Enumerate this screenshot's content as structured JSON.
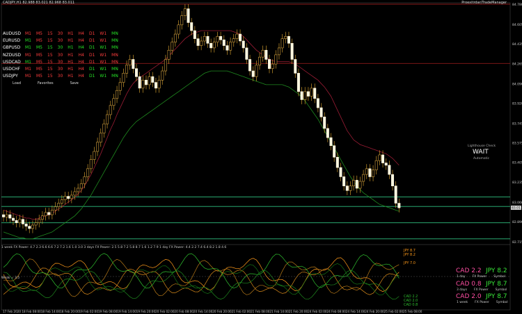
{
  "header": {
    "title": "CADJPY,H1  82.988 83.021 82.968 83.011",
    "right_label": "Proexitrdar/TradeManager"
  },
  "symbols": [
    {
      "name": "AUDUSD",
      "tfs": [
        {
          "l": "M1",
          "c": "#ff3d3d"
        },
        {
          "l": "M5",
          "c": "#ff3d3d"
        },
        {
          "l": "15",
          "c": "#ff3d3d"
        },
        {
          "l": "30",
          "c": "#ff3d3d"
        },
        {
          "l": "H1",
          "c": "#ff3d3d"
        },
        {
          "l": "H4",
          "c": "#ff3d3d"
        },
        {
          "l": "D1",
          "c": "#ff3d3d"
        },
        {
          "l": "W1",
          "c": "#ff3d3d"
        },
        {
          "l": "MN",
          "c": "#27e627"
        }
      ]
    },
    {
      "name": "EURUSD",
      "tfs": [
        {
          "l": "M1",
          "c": "#27e627"
        },
        {
          "l": "M5",
          "c": "#ff3d3d"
        },
        {
          "l": "15",
          "c": "#ff3d3d"
        },
        {
          "l": "30",
          "c": "#ff3d3d"
        },
        {
          "l": "H1",
          "c": "#ff3d3d"
        },
        {
          "l": "H4",
          "c": "#ff3d3d"
        },
        {
          "l": "D1",
          "c": "#ff3d3d"
        },
        {
          "l": "W1",
          "c": "#ff3d3d"
        },
        {
          "l": "MN",
          "c": "#27e627"
        }
      ]
    },
    {
      "name": "GBPUSD",
      "tfs": [
        {
          "l": "M1",
          "c": "#27e627"
        },
        {
          "l": "M5",
          "c": "#27e627"
        },
        {
          "l": "15",
          "c": "#27e627"
        },
        {
          "l": "30",
          "c": "#27e627"
        },
        {
          "l": "H1",
          "c": "#27e627"
        },
        {
          "l": "H4",
          "c": "#27e627"
        },
        {
          "l": "D1",
          "c": "#27e627"
        },
        {
          "l": "W1",
          "c": "#27e627"
        },
        {
          "l": "MN",
          "c": "#27e627"
        }
      ]
    },
    {
      "name": "NZDUSD",
      "tfs": [
        {
          "l": "M1",
          "c": "#ff3d3d"
        },
        {
          "l": "M5",
          "c": "#ff3d3d"
        },
        {
          "l": "15",
          "c": "#ff3d3d"
        },
        {
          "l": "30",
          "c": "#ff3d3d"
        },
        {
          "l": "H1",
          "c": "#ff3d3d"
        },
        {
          "l": "H4",
          "c": "#ff3d3d"
        },
        {
          "l": "D1",
          "c": "#ff3d3d"
        },
        {
          "l": "W1",
          "c": "#ff3d3d"
        },
        {
          "l": "MN",
          "c": "#ff3d3d"
        }
      ]
    },
    {
      "name": "USDCAD",
      "tfs": [
        {
          "l": "M1",
          "c": "#27e627"
        },
        {
          "l": "M5",
          "c": "#ff3d3d"
        },
        {
          "l": "15",
          "c": "#ff3d3d"
        },
        {
          "l": "30",
          "c": "#ff3d3d"
        },
        {
          "l": "H1",
          "c": "#ff3d3d"
        },
        {
          "l": "H4",
          "c": "#ff3d3d"
        },
        {
          "l": "D1",
          "c": "#ff3d3d"
        },
        {
          "l": "W1",
          "c": "#ff3d3d"
        },
        {
          "l": "MN",
          "c": "#ff3d3d"
        }
      ]
    },
    {
      "name": "USDCHF",
      "tfs": [
        {
          "l": "M1",
          "c": "#ff3d3d"
        },
        {
          "l": "M5",
          "c": "#ff3d3d"
        },
        {
          "l": "15",
          "c": "#ff3d3d"
        },
        {
          "l": "30",
          "c": "#ff3d3d"
        },
        {
          "l": "H1",
          "c": "#ff3d3d"
        },
        {
          "l": "H4",
          "c": "#ff3d3d"
        },
        {
          "l": "D1",
          "c": "#27e627"
        },
        {
          "l": "W1",
          "c": "#27e627"
        },
        {
          "l": "MN",
          "c": "#27e627"
        }
      ]
    },
    {
      "name": "USDJPY",
      "tfs": [
        {
          "l": "M1",
          "c": "#ff3d3d"
        },
        {
          "l": "M5",
          "c": "#ff3d3d"
        },
        {
          "l": "15",
          "c": "#ff3d3d"
        },
        {
          "l": "30",
          "c": "#ff3d3d"
        },
        {
          "l": "H1",
          "c": "#ff3d3d"
        },
        {
          "l": "H4",
          "c": "#ff3d3d"
        },
        {
          "l": "D1",
          "c": "#27e627"
        },
        {
          "l": "W1",
          "c": "#27e627"
        },
        {
          "l": "MN",
          "c": "#27e627"
        }
      ]
    }
  ],
  "panel_links": {
    "load": "Load",
    "favorites": "Favorites",
    "save": "Save"
  },
  "lighthouse": {
    "title": "Lighthouse Check",
    "status": "WAIT",
    "mode": "Automatic"
  },
  "indicator_label": "1 week FX Power: 4.7 2.3 6.6 6.6 7.2 7.2 1.6 1.0 3.0   3 days FX Power: 2.5 5.8 7.2 5.8 8.7 1.6 1.2 7.9   1 day FX Power: 4.4 2.2 7.4 6.4 8.2 1.8 4.6",
  "weak_label": "Weak = 3.5",
  "fx_power": [
    {
      "a": "CAD 2.2",
      "b": "JPY 8.2",
      "sub": [
        "1 day",
        "FX Power",
        "Symbol"
      ],
      "ac": "#ff4fa3",
      "bc": "#39e639"
    },
    {
      "a": "CAD 0.8",
      "b": "JPY 8.7",
      "sub": [
        "3 days",
        "FX Power",
        "Symbol"
      ],
      "ac": "#ff4fa3",
      "bc": "#39e639"
    },
    {
      "a": "CAD 2.0",
      "b": "JPY 8.7",
      "sub": [
        "1 week",
        "FX Power",
        "Symbol"
      ],
      "ac": "#ff4fa3",
      "bc": "#39e639"
    }
  ],
  "indicator_tags": [
    {
      "t": "JPY 8.7",
      "c": "#ff9a1a"
    },
    {
      "t": "JPY 8.2",
      "c": "#ff9a1a"
    },
    {
      "t": "JPY 7.0",
      "c": "#ff9a1a"
    },
    {
      "t": "CAD 2.2",
      "c": "#2fbf2f"
    },
    {
      "t": "CAD 2.0",
      "c": "#2fbf2f"
    },
    {
      "t": "CAD 0.8",
      "c": "#2fbf2f"
    }
  ],
  "chart_data": {
    "type": "candlestick",
    "title": "CADJPY,H1",
    "y_ticks": [
      "84.780",
      "84.605",
      "84.435",
      "84.265",
      "84.090",
      "83.920",
      "83.745",
      "83.575",
      "83.405",
      "83.235",
      "83.060",
      "82.890",
      "82.715"
    ],
    "ylim": [
      82.715,
      84.78
    ],
    "x_ticks": [
      "17 Feb 2020",
      "18 Feb 08:00",
      "18 Feb 14:00",
      "18 Feb 20:00",
      "19 Feb 02:00",
      "19 Feb 08:00",
      "19 Feb 14:00",
      "19 Feb 20:00",
      "20 Feb 02:00",
      "20 Feb 08:00",
      "20 Feb 14:00",
      "20 Feb 20:00",
      "21 Feb 02:00",
      "21 Feb 08:00",
      "21 Feb 14:00",
      "21 Feb 20:00",
      "24 Feb 02:00",
      "24 Feb 08:00",
      "24 Feb 14:00",
      "24 Feb 20:00",
      "25 Feb 02:00",
      "25 Feb 08:00"
    ],
    "closes": [
      82.93,
      82.95,
      82.92,
      82.9,
      82.88,
      82.91,
      82.87,
      82.85,
      82.83,
      82.86,
      82.88,
      82.91,
      82.94,
      82.97,
      82.95,
      82.99,
      83.02,
      83.05,
      83.08,
      83.11,
      83.09,
      83.12,
      83.15,
      83.18,
      83.22,
      83.28,
      83.35,
      83.43,
      83.5,
      83.58,
      83.66,
      83.74,
      83.82,
      83.9,
      83.96,
      84.03,
      84.1,
      84.18,
      84.25,
      84.3,
      84.22,
      84.15,
      84.05,
      84.12,
      84.08,
      84.15,
      84.1,
      84.05,
      84.12,
      84.2,
      84.3,
      84.38,
      84.45,
      84.52,
      84.6,
      84.68,
      84.74,
      84.62,
      84.55,
      84.48,
      84.42,
      84.46,
      84.5,
      84.44,
      84.4,
      84.45,
      84.5,
      84.47,
      84.42,
      84.38,
      84.45,
      84.48,
      84.52,
      84.46,
      84.4,
      84.3,
      84.2,
      84.15,
      84.25,
      84.32,
      84.38,
      84.3,
      84.22,
      84.26,
      84.34,
      84.4,
      84.48,
      84.5,
      84.44,
      84.3,
      84.18,
      84.02,
      83.95,
      84.02,
      83.98,
      84.05,
      83.96,
      83.88,
      83.8,
      83.7,
      83.62,
      83.55,
      83.45,
      83.36,
      83.28,
      83.2,
      83.16,
      83.2,
      83.25,
      83.18,
      83.24,
      83.3,
      83.35,
      83.28,
      83.34,
      83.42,
      83.47,
      83.4,
      83.38,
      83.3,
      83.2,
      83.05,
      83.01
    ],
    "ma_red": [
      82.99,
      82.98,
      82.97,
      82.96,
      82.95,
      82.94,
      82.93,
      82.92,
      82.92,
      82.91,
      82.91,
      82.92,
      82.93,
      82.94,
      82.95,
      82.96,
      82.98,
      83.0,
      83.02,
      83.04,
      83.06,
      83.08,
      83.1,
      83.13,
      83.16,
      83.2,
      83.25,
      83.3,
      83.36,
      83.42,
      83.48,
      83.55,
      83.62,
      83.69,
      83.75,
      83.82,
      83.88,
      83.94,
      84.0,
      84.05,
      84.09,
      84.12,
      84.14,
      84.16,
      84.18,
      84.2,
      84.22,
      84.24,
      84.26,
      84.28,
      84.3,
      84.33,
      84.36,
      84.39,
      84.42,
      84.45,
      84.48,
      84.5,
      84.52,
      84.53,
      84.54,
      84.55,
      84.55,
      84.55,
      84.55,
      84.55,
      84.55,
      84.55,
      84.55,
      84.55,
      84.55,
      84.54,
      84.53,
      84.52,
      84.5,
      84.47,
      84.44,
      84.41,
      84.38,
      84.36,
      84.34,
      84.32,
      84.3,
      84.29,
      84.28,
      84.28,
      84.28,
      84.28,
      84.28,
      84.27,
      84.26,
      84.24,
      84.22,
      84.2,
      84.18,
      84.16,
      84.14,
      84.12,
      84.09,
      84.06,
      84.02,
      83.98,
      83.92,
      83.86,
      83.8,
      83.74,
      83.68,
      83.64,
      83.6,
      83.58,
      83.56,
      83.55,
      83.54,
      83.53,
      83.52,
      83.51,
      83.5,
      83.49,
      83.48,
      83.46,
      83.44,
      83.41,
      83.38
    ],
    "ma_green": [
      82.8,
      82.79,
      82.78,
      82.77,
      82.76,
      82.75,
      82.75,
      82.74,
      82.74,
      82.74,
      82.75,
      82.76,
      82.77,
      82.78,
      82.79,
      82.8,
      82.82,
      82.84,
      82.86,
      82.88,
      82.9,
      82.92,
      82.94,
      82.97,
      83.0,
      83.04,
      83.08,
      83.12,
      83.17,
      83.22,
      83.27,
      83.32,
      83.37,
      83.42,
      83.47,
      83.52,
      83.57,
      83.62,
      83.66,
      83.7,
      83.73,
      83.76,
      83.78,
      83.8,
      83.82,
      83.84,
      83.86,
      83.88,
      83.9,
      83.92,
      83.94,
      83.96,
      83.98,
      84.0,
      84.02,
      84.04,
      84.06,
      84.08,
      84.1,
      84.12,
      84.14,
      84.16,
      84.18,
      84.19,
      84.2,
      84.2,
      84.2,
      84.2,
      84.2,
      84.2,
      84.19,
      84.18,
      84.17,
      84.16,
      84.15,
      84.14,
      84.13,
      84.12,
      84.11,
      84.1,
      84.09,
      84.08,
      84.08,
      84.08,
      84.08,
      84.08,
      84.08,
      84.07,
      84.06,
      84.04,
      84.02,
      84.0,
      83.97,
      83.94,
      83.9,
      83.86,
      83.82,
      83.78,
      83.73,
      83.68,
      83.63,
      83.58,
      83.53,
      83.48,
      83.43,
      83.38,
      83.33,
      83.28,
      83.24,
      83.2,
      83.17,
      83.14,
      83.12,
      83.1,
      83.08,
      83.06,
      83.04,
      83.03,
      83.02,
      83.01,
      83.0,
      82.99,
      82.98
    ],
    "h_lines": [
      {
        "y": 84.78,
        "color": "#8b1a1a"
      },
      {
        "y": 84.265,
        "color": "#8b1a1a"
      },
      {
        "y": 83.105,
        "color": "#2fbf7f"
      },
      {
        "y": 83.022,
        "color": "#2fbf7f"
      },
      {
        "y": 82.88,
        "color": "#2fbf7f"
      },
      {
        "y": 82.74,
        "color": "#2fbf7f"
      }
    ],
    "price_label": "83.011"
  }
}
